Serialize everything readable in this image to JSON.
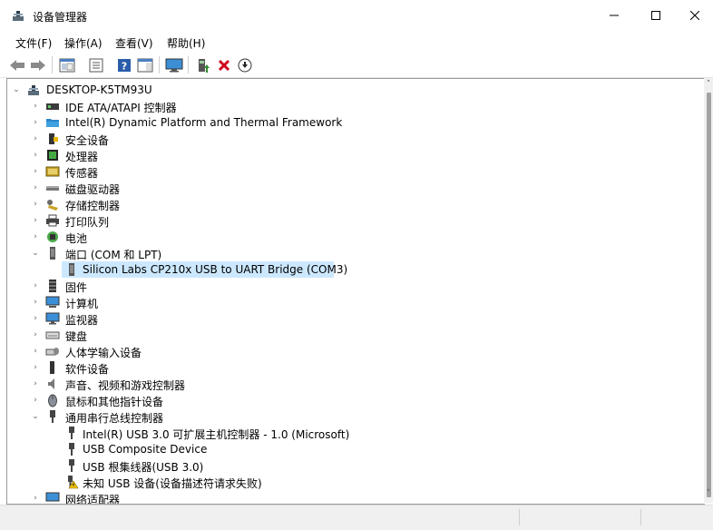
{
  "window": {
    "title": "设备管理器"
  },
  "menu": [
    "文件(F)",
    "操作(A)",
    "查看(V)",
    "帮助(H)"
  ],
  "toolbar": [
    "back-icon",
    "forward-icon",
    "show-hide-console-icon",
    "properties-icon",
    "help-icon",
    "action-pane-icon",
    "monitor-icon",
    "update-driver-icon",
    "uninstall-icon",
    "download-icon"
  ],
  "colors": {
    "selection": "#cce8ff",
    "uninstall_red": "#d0021b",
    "update_green": "#2e8b2e"
  },
  "tree": {
    "root": "DESKTOP-K5TM93U",
    "items": [
      {
        "label": "IDE ATA/ATAPI 控制器",
        "icon": "ide-controller-icon",
        "expanded": false
      },
      {
        "label": "Intel(R) Dynamic Platform and Thermal Framework",
        "icon": "thermal-framework-icon",
        "expanded": false
      },
      {
        "label": "安全设备",
        "icon": "security-device-icon",
        "expanded": false
      },
      {
        "label": "处理器",
        "icon": "processor-icon",
        "expanded": false
      },
      {
        "label": "传感器",
        "icon": "sensor-icon",
        "expanded": false
      },
      {
        "label": "磁盘驱动器",
        "icon": "disk-drive-icon",
        "expanded": false
      },
      {
        "label": "存储控制器",
        "icon": "storage-controller-icon",
        "expanded": false
      },
      {
        "label": "打印队列",
        "icon": "printer-icon",
        "expanded": false
      },
      {
        "label": "电池",
        "icon": "battery-icon",
        "expanded": false
      },
      {
        "label": "端口 (COM 和 LPT)",
        "icon": "port-icon",
        "expanded": true,
        "children": [
          {
            "label": "Silicon Labs CP210x USB to UART Bridge (COM3)",
            "icon": "port-device-icon",
            "selected": true
          }
        ]
      },
      {
        "label": "固件",
        "icon": "firmware-icon",
        "expanded": false
      },
      {
        "label": "计算机",
        "icon": "computer-icon",
        "expanded": false
      },
      {
        "label": "监视器",
        "icon": "monitor-icon",
        "expanded": false
      },
      {
        "label": "键盘",
        "icon": "keyboard-icon",
        "expanded": false
      },
      {
        "label": "人体学输入设备",
        "icon": "hid-icon",
        "expanded": false
      },
      {
        "label": "软件设备",
        "icon": "software-device-icon",
        "expanded": false
      },
      {
        "label": "声音、视频和游戏控制器",
        "icon": "audio-icon",
        "expanded": false
      },
      {
        "label": "鼠标和其他指针设备",
        "icon": "mouse-icon",
        "expanded": false
      },
      {
        "label": "通用串行总线控制器",
        "icon": "usb-controller-icon",
        "expanded": true,
        "children": [
          {
            "label": "Intel(R) USB 3.0 可扩展主机控制器 - 1.0 (Microsoft)",
            "icon": "usb-icon"
          },
          {
            "label": "USB Composite Device",
            "icon": "usb-icon"
          },
          {
            "label": "USB 根集线器(USB 3.0)",
            "icon": "usb-icon"
          },
          {
            "label": "未知 USB 设备(设备描述符请求失败)",
            "icon": "usb-warning-icon"
          }
        ]
      },
      {
        "label": "网络适配器",
        "icon": "network-adapter-icon",
        "expanded": false
      }
    ]
  }
}
